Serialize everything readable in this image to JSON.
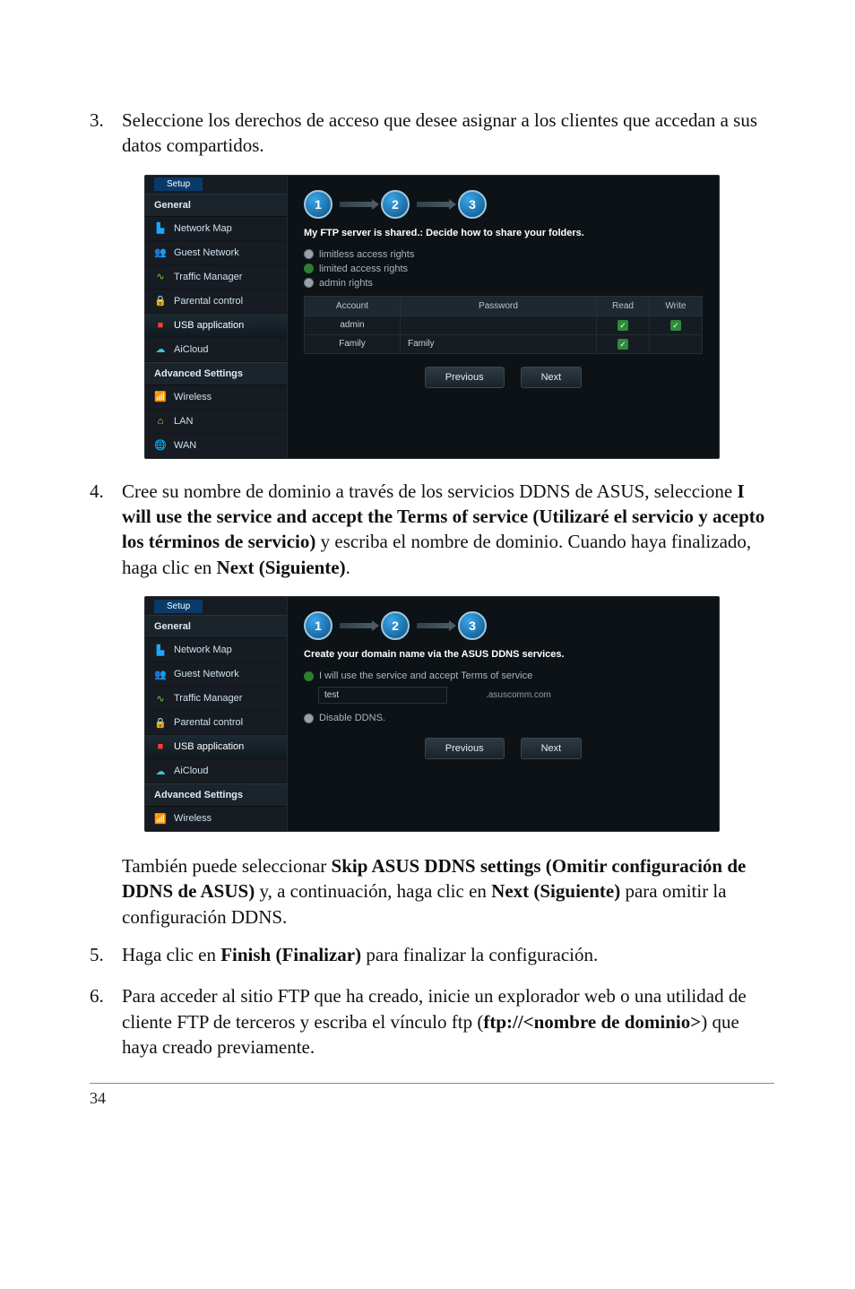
{
  "step3": {
    "num": "3.",
    "text": "Seleccione los derechos de acceso que desee asignar a los clientes que accedan a sus datos compartidos."
  },
  "router1": {
    "tab": "Setup",
    "general_head": "General",
    "adv_head": "Advanced Settings",
    "side_general": [
      "Network Map",
      "Guest Network",
      "Traffic Manager",
      "Parental control",
      "USB application",
      "AiCloud"
    ],
    "side_adv": [
      "Wireless",
      "LAN",
      "WAN"
    ],
    "steps": [
      "1",
      "2",
      "3"
    ],
    "title": "My FTP server is shared.: Decide how to share your folders.",
    "opt1": "limitless access rights",
    "opt2": "limited access rights",
    "opt3": "admin rights",
    "th": [
      "Account",
      "Password",
      "Read",
      "Write"
    ],
    "rows": [
      {
        "acct": "admin",
        "pwd": "",
        "r": true,
        "w": true
      },
      {
        "acct": "Family",
        "pwd": "Family",
        "r": true,
        "w": false
      }
    ],
    "prev": "Previous",
    "next": "Next"
  },
  "step4": {
    "num": "4.",
    "t1": "Cree su nombre de dominio a través de los servicios DDNS de ASUS, seleccione ",
    "b1": "I will use the service and accept the Terms of service (Utilizaré el servicio y acepto los términos de servicio)",
    "t2": " y escriba el nombre de dominio. Cuando haya finalizado, haga clic en ",
    "b2": "Next (Siguiente)",
    "t3": "."
  },
  "router2": {
    "tab": "Setup",
    "general_head": "General",
    "adv_head": "Advanced Settings",
    "side_general": [
      "Network Map",
      "Guest Network",
      "Traffic Manager",
      "Parental control",
      "USB application",
      "AiCloud"
    ],
    "side_adv": [
      "Wireless"
    ],
    "steps": [
      "1",
      "2",
      "3"
    ],
    "title": "Create your domain name via the ASUS DDNS services.",
    "opt1": "I will use the service and accept Terms of service",
    "field_val": "test",
    "suffix": ".asuscomm.com",
    "opt2": "Disable DDNS.",
    "prev": "Previous",
    "next": "Next"
  },
  "foot4": {
    "t1": "También puede seleccionar ",
    "b1": "Skip ASUS DDNS settings (Omitir configuración de DDNS de ASUS)",
    "t2": " y, a continuación, haga clic en ",
    "b2": "Next (Siguiente)",
    "t3": " para omitir la configuración DDNS."
  },
  "step5": {
    "num": "5.",
    "t1": "Haga clic en ",
    "b1": "Finish (Finalizar)",
    "t2": " para finalizar la configuración."
  },
  "step6": {
    "num": "6.",
    "t1": "Para acceder al sitio FTP que ha creado, inicie un explorador web o una utilidad de cliente FTP de terceros y escriba el vínculo ftp (",
    "b1": "ftp://<nombre de dominio>",
    "t2": ") que haya creado previamente."
  },
  "page_num": "34"
}
